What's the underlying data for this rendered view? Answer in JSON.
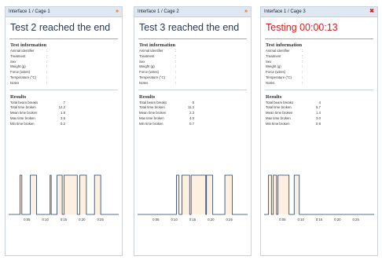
{
  "panels": [
    {
      "title": "Interface 1 / Cage 1",
      "heading": "Test 2 reached the end",
      "test_info_title": "Test information",
      "info_labels": [
        "Animal identifier",
        "Treatment",
        "Sex",
        "Weight (g)",
        "Force (wires)",
        "Temperature (°C)",
        "Notes"
      ],
      "results_title": "Results",
      "results": [
        {
          "label": "Total beam breaks",
          "value": "7"
        },
        {
          "label": "Total time broken",
          "value": "12.2"
        },
        {
          "label": "Mean time broken",
          "value": "1.8"
        },
        {
          "label": "Max time broken",
          "value": "3.6"
        },
        {
          "label": "Min time broken",
          "value": "0.2"
        }
      ],
      "chart_data": {
        "type": "area",
        "x_ticks": [
          "0:05",
          "0:10",
          "0:15",
          "0:20",
          "0:25"
        ],
        "x_range": [
          0,
          30
        ],
        "breaks": [
          [
            3.1,
            3.6
          ],
          [
            5.9,
            7.6
          ],
          [
            11.3,
            11.6
          ],
          [
            13.2,
            14.6
          ],
          [
            15.1,
            18.7
          ],
          [
            19.4,
            21.2
          ],
          [
            23.4,
            25.1
          ]
        ],
        "line_color": "#1f3f66",
        "fill_color": "#fdf0e1"
      }
    },
    {
      "title": "Interface 1 / Cage 2",
      "heading": "Test 3 reached the end",
      "test_info_title": "Test information",
      "info_labels": [
        "Animal identifier",
        "Treatment",
        "Sex",
        "Weight (g)",
        "Force (wires)",
        "Temperature (°C)",
        "Notes"
      ],
      "results_title": "Results",
      "results": [
        {
          "label": "Total beam breaks",
          "value": "5"
        },
        {
          "label": "Total time broken",
          "value": "11.3"
        },
        {
          "label": "Mean time broken",
          "value": "2.3"
        },
        {
          "label": "Max time broken",
          "value": "4.0"
        },
        {
          "label": "Min time broken",
          "value": "0.7"
        }
      ],
      "chart_data": {
        "type": "area",
        "x_ticks": [
          "0:05",
          "0:10",
          "0:15",
          "0:20",
          "0:25"
        ],
        "x_range": [
          0,
          30
        ],
        "breaks": [
          [
            10.6,
            11.3
          ],
          [
            12.1,
            14.2
          ],
          [
            14.6,
            18.6
          ],
          [
            18.8,
            20.5
          ],
          [
            23.8,
            25.8
          ]
        ],
        "line_color": "#1f3f66",
        "fill_color": "#fdf0e1"
      }
    },
    {
      "title": "Interface 1 / Cage 3",
      "heading": "Testing 00:00:13",
      "test_info_title": "Test information",
      "info_labels": [
        "Animal identifier",
        "Treatment",
        "Sex",
        "Weight (g)",
        "Force (wires)",
        "Temperature (°C)",
        "Notes"
      ],
      "results_title": "Results",
      "results": [
        {
          "label": "Total beam breaks",
          "value": "4"
        },
        {
          "label": "Total time broken",
          "value": "5.7"
        },
        {
          "label": "Mean time broken",
          "value": "1.4"
        },
        {
          "label": "Max time broken",
          "value": "3.0"
        },
        {
          "label": "Min time broken",
          "value": "0.8"
        }
      ],
      "chart_data": {
        "type": "area",
        "x_ticks": [
          "0:05",
          "0:10",
          "0:15",
          "0:20",
          "0:25"
        ],
        "x_range": [
          0,
          30
        ],
        "breaks": [
          [
            1.2,
            2.0
          ],
          [
            2.5,
            3.4
          ],
          [
            3.8,
            6.8
          ],
          [
            8.2,
            9.6
          ]
        ],
        "line_color": "#1f3f66",
        "fill_color": "#fdf0e1"
      }
    }
  ],
  "close_icon": "close-icon",
  "alert_color": "#d11f1f"
}
